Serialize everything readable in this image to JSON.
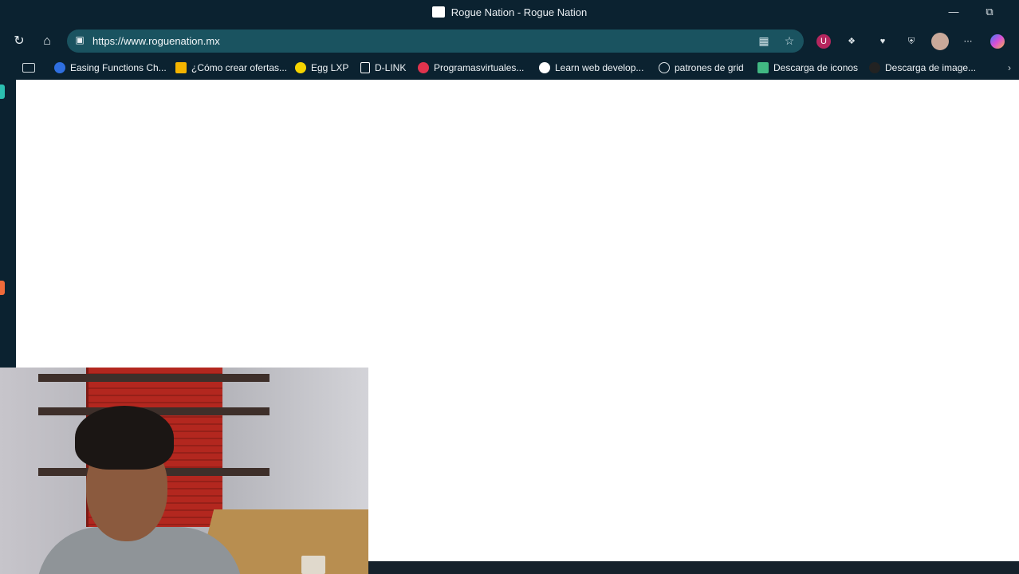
{
  "window": {
    "title": "Rogue Nation - Rogue Nation"
  },
  "address_bar": {
    "url": "https://www.roguenation.mx"
  },
  "bookmarks": [
    {
      "label": "Easing Functions Ch...",
      "icon": "globe-blue-icon"
    },
    {
      "label": "¿Cómo crear ofertas...",
      "icon": "ads-icon"
    },
    {
      "label": "Egg LXP",
      "icon": "egg-icon"
    },
    {
      "label": "D-LINK",
      "icon": "dlink-icon"
    },
    {
      "label": "Programasvirtuales...",
      "icon": "p-circle-icon"
    },
    {
      "label": "Learn web develop...",
      "icon": "dino-icon"
    },
    {
      "label": "patrones de grid",
      "icon": "globe-icon"
    },
    {
      "label": "Descarga de iconos",
      "icon": "vue-icon"
    },
    {
      "label": "Descarga de image...",
      "icon": "person-icon"
    }
  ],
  "colors": {
    "chrome": "#0b2230",
    "omnibox": "#1a5360",
    "page": "#ffffff"
  }
}
